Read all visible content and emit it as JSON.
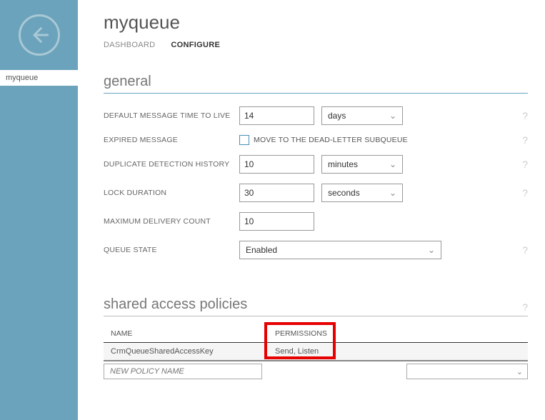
{
  "sidebar": {
    "item": "myqueue"
  },
  "header": {
    "title": "myqueue",
    "tabs": {
      "dashboard": "DASHBOARD",
      "configure": "CONFIGURE"
    }
  },
  "general": {
    "title": "general",
    "ttl": {
      "label": "DEFAULT MESSAGE TIME TO LIVE",
      "value": "14",
      "unit": "days"
    },
    "expired": {
      "label": "EXPIRED MESSAGE",
      "checkbox_label": "MOVE TO THE DEAD-LETTER SUBQUEUE"
    },
    "dup": {
      "label": "DUPLICATE DETECTION HISTORY",
      "value": "10",
      "unit": "minutes"
    },
    "lock": {
      "label": "LOCK DURATION",
      "value": "30",
      "unit": "seconds"
    },
    "maxdel": {
      "label": "MAXIMUM DELIVERY COUNT",
      "value": "10"
    },
    "state": {
      "label": "QUEUE STATE",
      "value": "Enabled"
    }
  },
  "policies": {
    "title": "shared access policies",
    "cols": {
      "name": "NAME",
      "perms": "PERMISSIONS"
    },
    "row": {
      "name": "CrmQueueSharedAccessKey",
      "perms": "Send, Listen"
    },
    "new_placeholder": "NEW POLICY NAME"
  }
}
